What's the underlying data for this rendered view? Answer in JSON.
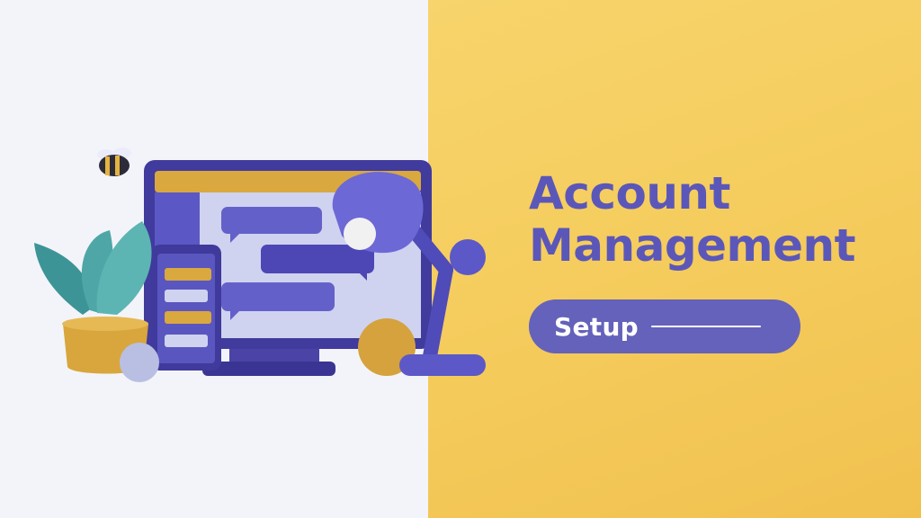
{
  "banner": {
    "title_line1": "Account",
    "title_line2": "Management",
    "tag_label": "Setup"
  },
  "illustration_elements": [
    "bee-icon",
    "plant-icon",
    "monitor-icon",
    "chat-bubble-icon",
    "smartphone-icon",
    "desk-lamp-icon",
    "sphere-icon"
  ],
  "colors": {
    "left_background": "#f3f4f9",
    "right_background": "#f5cd5e",
    "accent_purple": "#5b57b9",
    "pill_background": "#6462ba",
    "gold": "#d9a83f",
    "teal": "#4fa6a6"
  }
}
